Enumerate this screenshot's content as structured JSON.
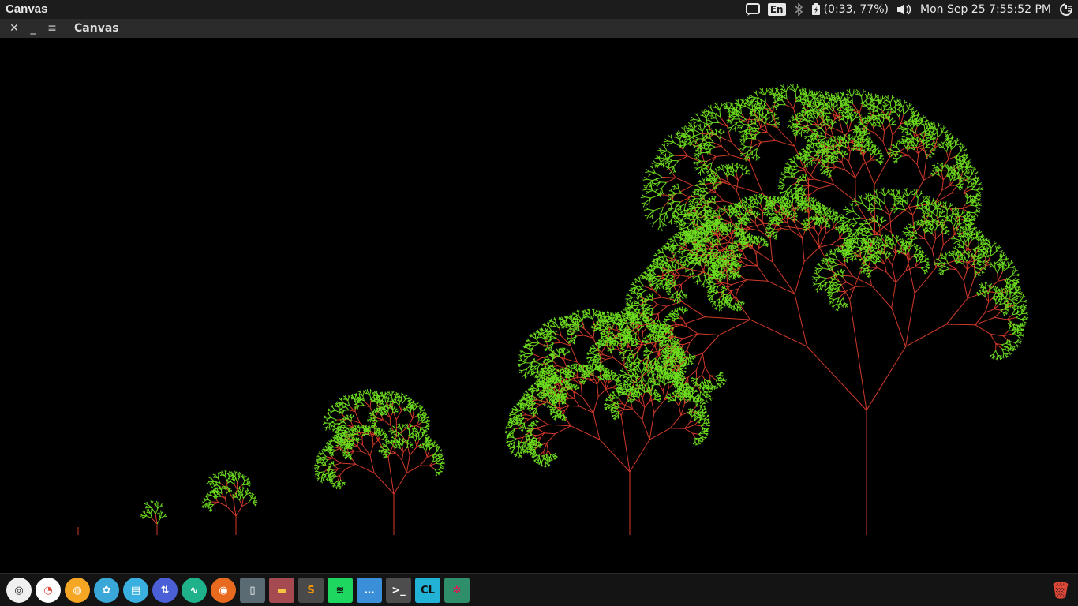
{
  "top_panel": {
    "app_name": "Canvas",
    "keyboard_layout": "En",
    "battery_status": "(0:33, 77%)",
    "clock": "Mon Sep 25  7:55:52 PM"
  },
  "window": {
    "title": "Canvas",
    "close_label": "✕",
    "minimize_label": "_",
    "menu_label": "≡"
  },
  "canvas": {
    "background_color": "#000000",
    "trunk_color": "#d23a2a",
    "leaf_color": "#6ddc1e",
    "trees": [
      {
        "depth": 0
      },
      {
        "depth": 4
      },
      {
        "depth": 6
      },
      {
        "depth": 8
      },
      {
        "depth": 9
      },
      {
        "depth": 10
      }
    ]
  },
  "dock": {
    "items": [
      {
        "name": "ubuntu-dash-icon",
        "glyph": "◎",
        "color": "#f0f0f0",
        "text_color": "#222"
      },
      {
        "name": "disk-usage-icon",
        "glyph": "◔",
        "color": "#ffffff",
        "text_color": "#e0483a"
      },
      {
        "name": "software-center-icon",
        "glyph": "◍",
        "color": "#f5a623",
        "text_color": "#fff"
      },
      {
        "name": "settings-icon",
        "glyph": "✿",
        "color": "#3aa7d9",
        "text_color": "#fff"
      },
      {
        "name": "text-editor-icon",
        "glyph": "▤",
        "color": "#3ab0e0",
        "text_color": "#fff"
      },
      {
        "name": "transfer-icon",
        "glyph": "⇅",
        "color": "#4b5fd6",
        "text_color": "#fff"
      },
      {
        "name": "system-monitor-icon",
        "glyph": "∿",
        "color": "#1fb28a",
        "text_color": "#fff"
      },
      {
        "name": "firefox-icon",
        "glyph": "◉",
        "color": "#e86a1f",
        "text_color": "#fff"
      },
      {
        "name": "document-viewer-icon",
        "glyph": "▯",
        "color": "#5a6b73",
        "text_color": "#fff"
      },
      {
        "name": "files-icon",
        "glyph": "▬",
        "color": "#a64a52",
        "text_color": "#f4c542"
      },
      {
        "name": "sublime-text-icon",
        "glyph": "S",
        "color": "#4a4a4a",
        "text_color": "#ff9800"
      },
      {
        "name": "spotify-icon",
        "glyph": "≋",
        "color": "#1ed760",
        "text_color": "#111"
      },
      {
        "name": "more-apps-icon",
        "glyph": "…",
        "color": "#3a8fd8",
        "text_color": "#fff"
      },
      {
        "name": "terminal-icon",
        "glyph": ">_",
        "color": "#4d4d4d",
        "text_color": "#fff"
      },
      {
        "name": "clion-icon",
        "glyph": "CL",
        "color": "#22b2d6",
        "text_color": "#111"
      },
      {
        "name": "canvas-app-icon",
        "glyph": "✲",
        "color": "#2f8f6a",
        "text_color": "#f05"
      }
    ],
    "trash": {
      "name": "trash-icon",
      "glyph": "🗑",
      "color": "#e0483a"
    }
  }
}
